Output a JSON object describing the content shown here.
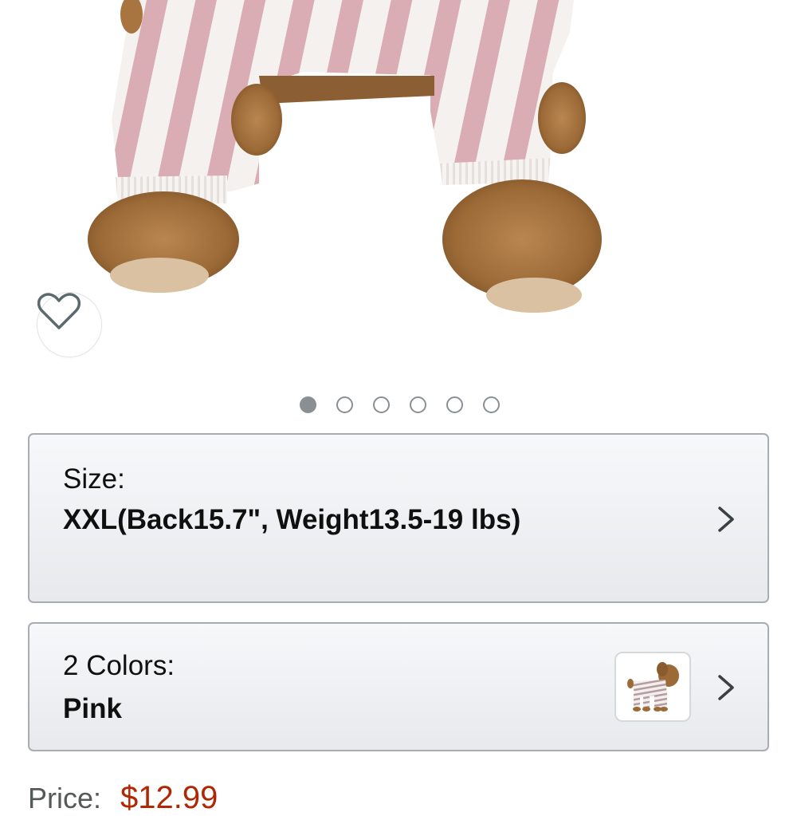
{
  "gallery": {
    "image_count": 6,
    "active_index": 0
  },
  "favorite": {
    "icon": "heart-outline-icon"
  },
  "size_option": {
    "label": "Size:",
    "value": "XXL(Back15.7\", Weight13.5-19 lbs)"
  },
  "color_option": {
    "label": "2 Colors:",
    "value": "Pink"
  },
  "price": {
    "label": "Price:",
    "value": "$12.99"
  },
  "colors": {
    "border": "#a9adb1",
    "price": "#b12704",
    "dot": "#8a8f94",
    "stripe_pink": "#d6a7ae",
    "fur": "#a8743f"
  }
}
